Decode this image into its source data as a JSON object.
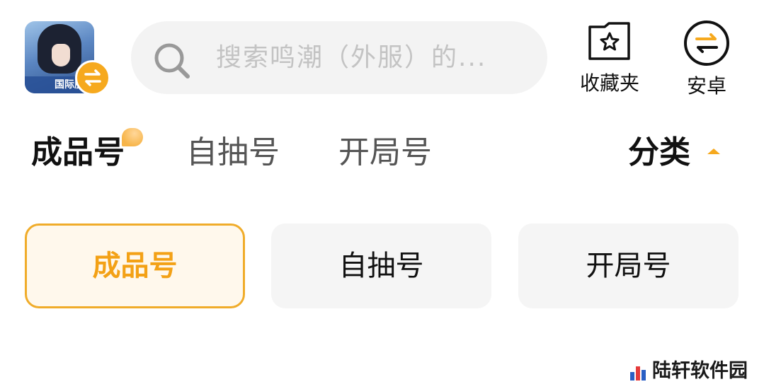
{
  "header": {
    "app_icon": {
      "banner_text": "国际服"
    },
    "search": {
      "placeholder": "搜索鸣潮（外服）的..."
    },
    "favorites": {
      "label": "收藏夹",
      "icon": "star-folder-icon"
    },
    "platform": {
      "label": "安卓",
      "icon": "swap-arrows-icon"
    }
  },
  "tabs": [
    {
      "label": "成品号",
      "active": true
    },
    {
      "label": "自抽号",
      "active": false
    },
    {
      "label": "开局号",
      "active": false
    }
  ],
  "category": {
    "label": "分类",
    "icon": "caret-up-icon"
  },
  "chips": [
    {
      "label": "成品号",
      "selected": true
    },
    {
      "label": "自抽号",
      "selected": false
    },
    {
      "label": "开局号",
      "selected": false
    }
  ],
  "watermark": {
    "text": "陆轩软件园"
  },
  "colors": {
    "accent": "#f6a91e",
    "search_bg": "#f3f3f3",
    "chip_bg": "#f5f5f5"
  }
}
